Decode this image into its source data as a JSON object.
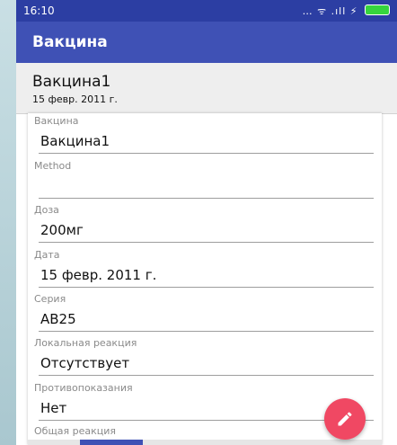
{
  "status_bar": {
    "time": "16:10",
    "icons": "… ᯤ .ıll ⚡"
  },
  "app_bar": {
    "title": "Вакцина"
  },
  "header": {
    "name": "Вакцина1",
    "date": "15 февр. 2011 г."
  },
  "form": {
    "fields": [
      {
        "label": "Вакцина",
        "value": "Вакцина1"
      },
      {
        "label": "Method",
        "value": ""
      },
      {
        "label": "Доза",
        "value": "200мг"
      },
      {
        "label": "Дата",
        "value": "15 февр. 2011 г."
      },
      {
        "label": "Серия",
        "value": "AB25"
      },
      {
        "label": "Локальная реакция",
        "value": "Отсутствует"
      },
      {
        "label": "Противопоказания",
        "value": "Нет"
      },
      {
        "label": "Общая реакция",
        "value": ""
      }
    ]
  },
  "fab": {
    "icon": "pencil-icon"
  },
  "colors": {
    "primary": "#3f51b5",
    "primary_dark": "#2c3ea3",
    "accent": "#f04863"
  }
}
